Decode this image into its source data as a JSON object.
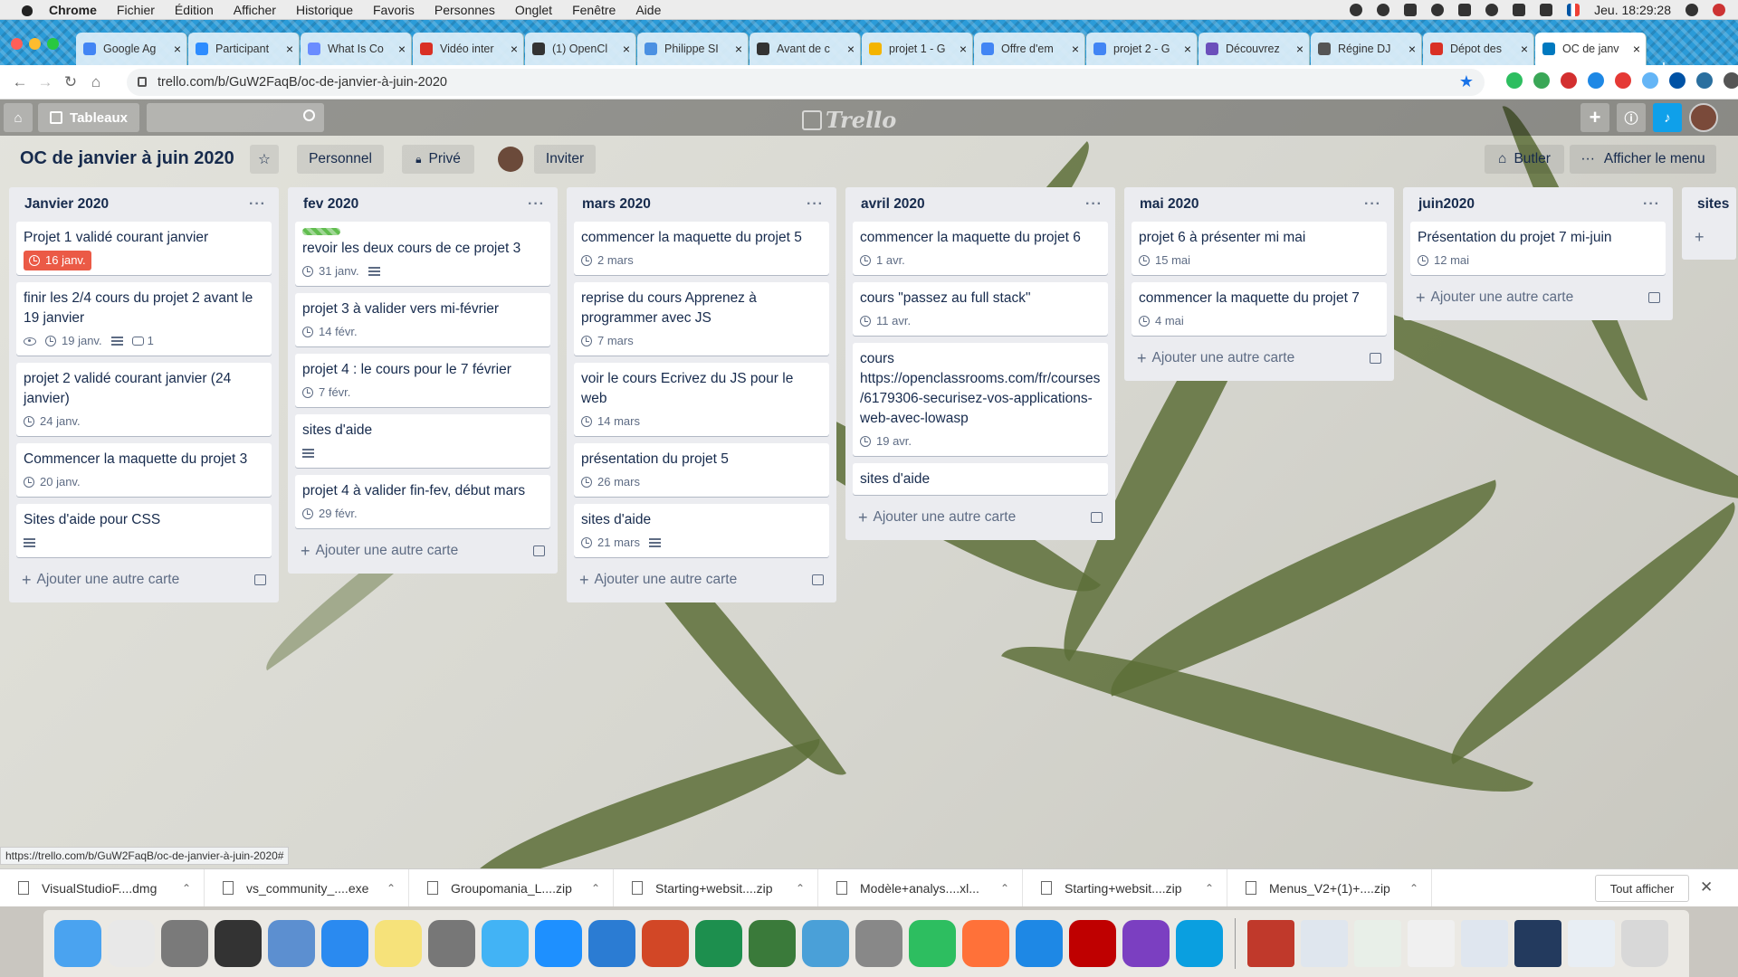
{
  "menubar": {
    "app": "Chrome",
    "items": [
      "Fichier",
      "Édition",
      "Afficher",
      "Historique",
      "Favoris",
      "Personnes",
      "Onglet",
      "Fenêtre",
      "Aide"
    ],
    "clock": "Jeu. 18:29:28"
  },
  "tabs": [
    {
      "title": "Google Ag",
      "color": "#4285f4"
    },
    {
      "title": "Participant",
      "color": "#2d8cff"
    },
    {
      "title": "What Is Co",
      "color": "#6a8cff"
    },
    {
      "title": "Vidéo inter",
      "color": "#d93025"
    },
    {
      "title": "(1) OpenCl",
      "color": "#333333"
    },
    {
      "title": "Philippe SI",
      "color": "#4a90e2"
    },
    {
      "title": "Avant de c",
      "color": "#333333"
    },
    {
      "title": "projet 1 - G",
      "color": "#f4b400"
    },
    {
      "title": "Offre d'em",
      "color": "#4285f4"
    },
    {
      "title": "projet 2 - G",
      "color": "#4285f4"
    },
    {
      "title": "Découvrez",
      "color": "#6b4fbb"
    },
    {
      "title": "Régine DJ",
      "color": "#555555"
    },
    {
      "title": "Dépot des",
      "color": "#d93025"
    },
    {
      "title": "OC de janv",
      "color": "#0079bf"
    }
  ],
  "address": {
    "url": "trello.com/b/GuW2FaqB/oc-de-janvier-à-juin-2020"
  },
  "header": {
    "boards_label": "Tableaux",
    "logo": "Trello"
  },
  "board": {
    "title": "OC de janvier à juin 2020",
    "team": "Personnel",
    "visibility": "Privé",
    "invite": "Inviter",
    "butler": "Butler",
    "menu": "Afficher le menu"
  },
  "add_card_label": "Ajouter une autre carte",
  "lists": [
    {
      "name": "Janvier 2020",
      "cards": [
        {
          "title": "Projet 1 validé courant janvier",
          "date": "16 janv.",
          "due": true
        },
        {
          "title": "finir les 2/4 cours du projet 2 avant le 19 janvier",
          "date": "19 janv.",
          "watch": true,
          "desc": true,
          "comments": "1"
        },
        {
          "title": "projet 2 validé courant janvier (24 janvier)",
          "date": "24 janv."
        },
        {
          "title": "Commencer la maquette du projet 3",
          "date": "20 janv."
        },
        {
          "title": "Sites d'aide pour CSS",
          "desc": true
        }
      ]
    },
    {
      "name": "fev 2020",
      "cards": [
        {
          "title": "revoir les deux cours de ce projet 3",
          "date": "31 janv.",
          "desc": true,
          "label": true
        },
        {
          "title": "projet 3 à valider vers mi-février",
          "date": "14 févr."
        },
        {
          "title": "projet 4 : le cours pour le 7 février",
          "date": "7 févr."
        },
        {
          "title": "sites d'aide",
          "desc": true
        },
        {
          "title": "projet 4 à valider fin-fev, début mars",
          "date": "29 févr."
        }
      ]
    },
    {
      "name": "mars 2020",
      "cards": [
        {
          "title": "commencer la maquette du projet 5",
          "date": "2 mars"
        },
        {
          "title": "reprise du cours Apprenez à programmer avec JS",
          "date": "7 mars"
        },
        {
          "title": "voir le cours Ecrivez du JS pour le web",
          "date": "14 mars"
        },
        {
          "title": "présentation du projet 5",
          "date": "26 mars"
        },
        {
          "title": "sites d'aide",
          "date": "21 mars",
          "desc": true
        }
      ]
    },
    {
      "name": "avril 2020",
      "cards": [
        {
          "title": "commencer la maquette du projet 6",
          "date": "1 avr."
        },
        {
          "title": "cours \"passez au full stack\"",
          "date": "11 avr."
        },
        {
          "title": "cours https://openclassrooms.com/fr/courses/6179306-securisez-vos-applications-web-avec-lowasp",
          "date": "19 avr."
        },
        {
          "title": "sites d'aide"
        }
      ]
    },
    {
      "name": "mai 2020",
      "cards": [
        {
          "title": "projet 6 à présenter mi mai",
          "date": "15 mai"
        },
        {
          "title": "commencer la maquette du projet 7",
          "date": "4 mai"
        }
      ]
    },
    {
      "name": "juin2020",
      "cards": [
        {
          "title": "Présentation du projet 7 mi-juin",
          "date": "12 mai"
        }
      ]
    },
    {
      "name": "sites",
      "cards": []
    }
  ],
  "status_url": "https://trello.com/b/GuW2FaqB/oc-de-janvier-à-juin-2020#",
  "downloads": [
    "VisualStudioF....dmg",
    "vs_community_....exe",
    "Groupomania_L....zip",
    "Starting+websit....zip",
    "Modèle+analys....xl...",
    "Starting+websit....zip",
    "Menus_V2+(1)+....zip"
  ],
  "show_all": "Tout afficher",
  "dock": [
    {
      "name": "Finder",
      "color": "#4aa3f0"
    },
    {
      "name": "Chrome",
      "color": "#e8e8e8"
    },
    {
      "name": "Launchpad",
      "color": "#7a7a7a"
    },
    {
      "name": "Photo Booth",
      "color": "#333"
    },
    {
      "name": "Aperçu",
      "color": "#5c8fd0"
    },
    {
      "name": "Safari",
      "color": "#2a8af0"
    },
    {
      "name": "Notes",
      "color": "#f6e27a"
    },
    {
      "name": "Préférences Système",
      "color": "#777"
    },
    {
      "name": "Messages",
      "color": "#42b3f5"
    },
    {
      "name": "App Store",
      "color": "#1e90ff"
    },
    {
      "name": "Word",
      "color": "#2b7cd3"
    },
    {
      "name": "PowerPoint",
      "color": "#d24726"
    },
    {
      "name": "Excel",
      "color": "#1d8f4e"
    },
    {
      "name": "Site Web",
      "color": "#3a7a3a"
    },
    {
      "name": "Contacts",
      "color": "#4aa0d8"
    },
    {
      "name": "Migration",
      "color": "#888"
    },
    {
      "name": "Evernote",
      "color": "#2dbe60"
    },
    {
      "name": "Firefox",
      "color": "#ff7139"
    },
    {
      "name": "VS Code",
      "color": "#1e88e5"
    },
    {
      "name": "FileZilla",
      "color": "#bf0000"
    },
    {
      "name": "Visual Studio",
      "color": "#7b3fc1"
    },
    {
      "name": "Skype",
      "color": "#0a9fe0"
    }
  ]
}
